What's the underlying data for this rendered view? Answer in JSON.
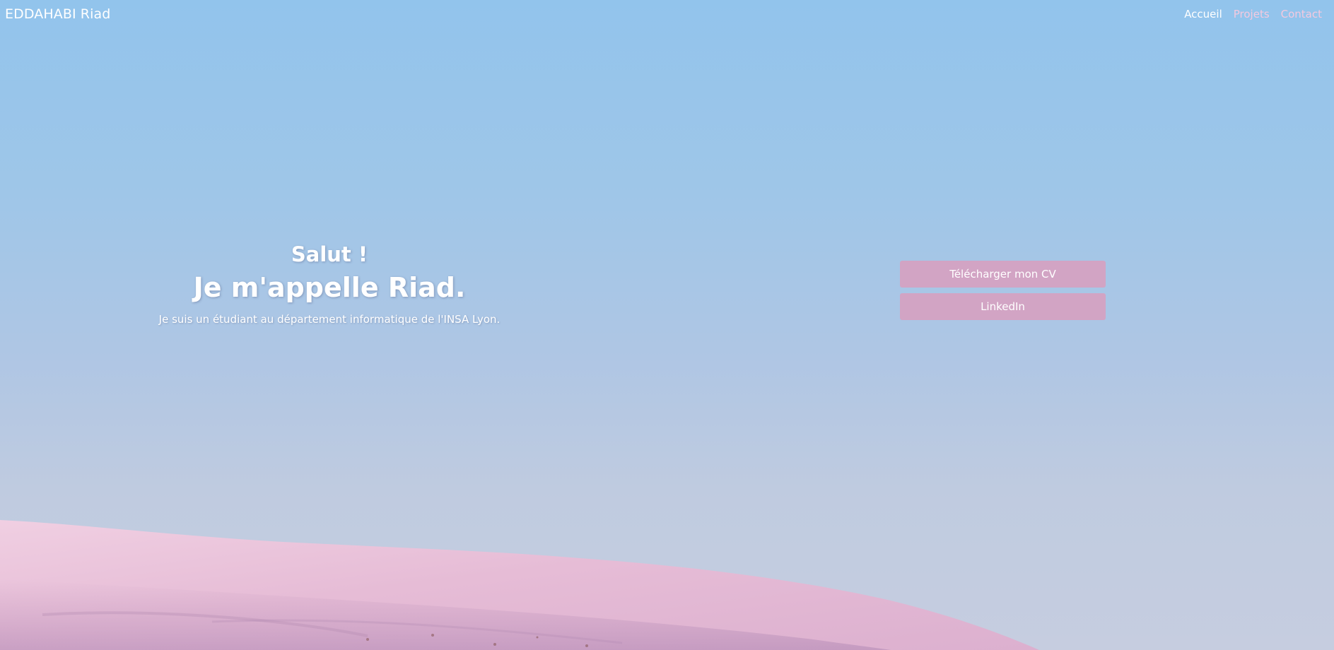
{
  "navbar": {
    "brand": "EDDAHABI Riad",
    "links": [
      {
        "label": "Accueil"
      },
      {
        "label": "Projets"
      },
      {
        "label": "Contact"
      }
    ]
  },
  "hero": {
    "greeting": "Salut !",
    "name_line": "Je m'appelle Riad.",
    "description": "Je suis un étudiant au département informatique de l'INSA Lyon."
  },
  "actions": {
    "cv_label": "Télécharger mon CV",
    "linkedin_label": "LinkedIn"
  },
  "colors": {
    "sky_top": "#92c4ec",
    "sky_bottom": "#c6cde0",
    "hill": "#e8c0d8",
    "button": "#d2a4c4",
    "nav_link_pink": "#f3c9df"
  }
}
